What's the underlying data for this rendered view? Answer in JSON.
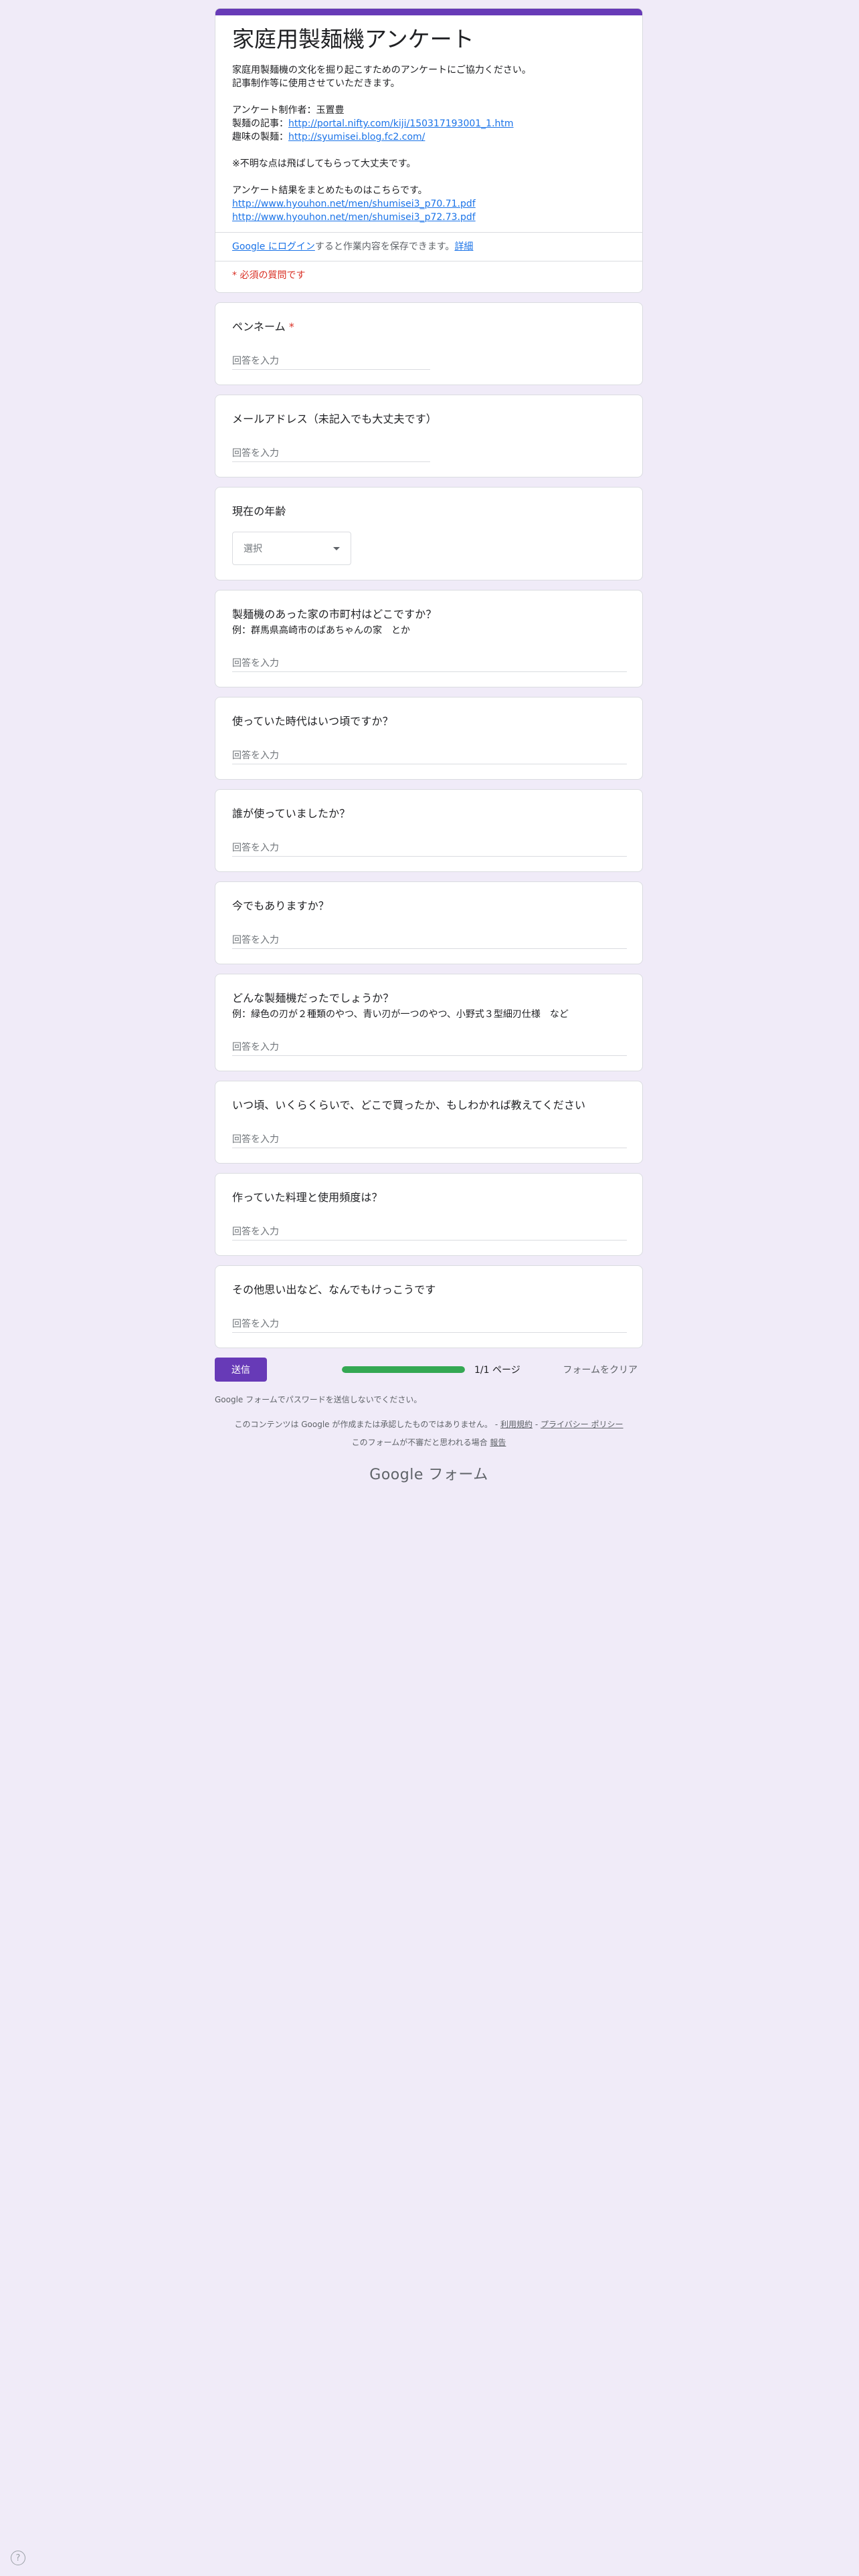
{
  "form": {
    "title": "家庭用製麺機アンケート",
    "description_lines": [
      {
        "text": "家庭用製麺機の文化を掘り起こすためのアンケートにご協力ください。"
      },
      {
        "text": "記事制作等に使用させていただきます。"
      },
      {
        "text": ""
      },
      {
        "text": "アンケート制作者：玉置豊"
      },
      {
        "prefix": "製麺の記事：",
        "link": "http://portal.nifty.com/kiji/150317193001_1.htm"
      },
      {
        "prefix": "趣味の製麺：",
        "link": "http://syumisei.blog.fc2.com/"
      },
      {
        "text": ""
      },
      {
        "text": "※不明な点は飛ばしてもらって大丈夫です。"
      },
      {
        "text": ""
      },
      {
        "text": "アンケート結果をまとめたものはこちらです。"
      },
      {
        "link": "http://www.hyouhon.net/men/shumisei3_p70.71.pdf"
      },
      {
        "link": "http://www.hyouhon.net/men/shumisei3_p72.73.pdf"
      }
    ],
    "login_link": "Google にログイン",
    "login_text": "すると作業内容を保存できます。",
    "login_details": "詳細",
    "required_note": "* 必須の質問です"
  },
  "questions": [
    {
      "title": "ペンネーム",
      "required": "*",
      "help": "",
      "placeholder": "回答を入力",
      "type": "short"
    },
    {
      "title": "メールアドレス（未記入でも大丈夫です）",
      "required": "",
      "help": "",
      "placeholder": "回答を入力",
      "type": "short"
    },
    {
      "title": "現在の年齢",
      "required": "",
      "help": "",
      "placeholder": "選択",
      "type": "select"
    },
    {
      "title": "製麺機のあった家の市町村はどこですか？",
      "required": "",
      "help": "例：群馬県高崎市のばあちゃんの家　とか",
      "placeholder": "回答を入力",
      "type": "long"
    },
    {
      "title": "使っていた時代はいつ頃ですか？",
      "required": "",
      "help": "",
      "placeholder": "回答を入力",
      "type": "long"
    },
    {
      "title": "誰が使っていましたか？",
      "required": "",
      "help": "",
      "placeholder": "回答を入力",
      "type": "long"
    },
    {
      "title": "今でもありますか？",
      "required": "",
      "help": "",
      "placeholder": "回答を入力",
      "type": "long"
    },
    {
      "title": "どんな製麺機だったでしょうか？",
      "required": "",
      "help": "例：緑色の刃が２種類のやつ、青い刃が一つのやつ、小野式３型細刃仕様　など",
      "placeholder": "回答を入力",
      "type": "long"
    },
    {
      "title": "いつ頃、いくらくらいで、どこで買ったか、もしわかれば教えてください",
      "required": "",
      "help": "",
      "placeholder": "回答を入力",
      "type": "long"
    },
    {
      "title": "作っていた料理と使用頻度は？",
      "required": "",
      "help": "",
      "placeholder": "回答を入力",
      "type": "long"
    },
    {
      "title": "その他思い出など、なんでもけっこうです",
      "required": "",
      "help": "",
      "placeholder": "回答を入力",
      "type": "long"
    }
  ],
  "footer": {
    "submit_label": "送信",
    "progress_text": "1/1 ページ",
    "progress_fraction": 1.0,
    "clear_label": "フォームをクリア",
    "password_note": "Google フォームでパスワードを送信しないでください。",
    "disclaimer_text": "このコンテンツは Google が作成または承認したものではありません。 - ",
    "terms_link": "利用規約",
    "separator": " - ",
    "privacy_link": "プライバシー ポリシー",
    "report_text": "このフォームが不審だと思われる場合 ",
    "report_link": "報告",
    "brand": "Google フォーム",
    "help_glyph": "?"
  },
  "colors": {
    "background": "#f0ebf8",
    "accent": "#673ab7",
    "progress": "#34a853",
    "required": "#d93025",
    "link": "#1a73e8"
  }
}
